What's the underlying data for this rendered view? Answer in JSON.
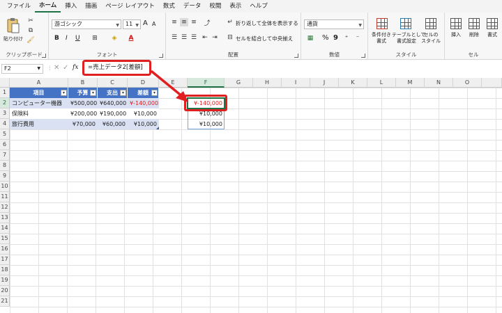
{
  "menu": [
    "ファイル",
    "ホーム",
    "挿入",
    "描画",
    "ページ レイアウト",
    "数式",
    "データ",
    "校閲",
    "表示",
    "ヘルプ"
  ],
  "ribbon": {
    "clipboard": {
      "paste": "貼り付け",
      "label": "クリップボード"
    },
    "font": {
      "name": "游ゴシック",
      "size": "11",
      "grow": "A",
      "shrink": "A",
      "bold": "B",
      "italic": "I",
      "underline": "U",
      "label": "フォント"
    },
    "alignment": {
      "wrap": "折り返して全体を表示する",
      "merge": "セルを結合して中央揃え",
      "label": "配置"
    },
    "number": {
      "format": "通貨",
      "percent": "%",
      "comma": "9",
      "label": "数値"
    },
    "styles": {
      "conditional": "条件付き\n書式",
      "table": "テーブルとして\n書式設定",
      "cell": "セルの\nスタイル",
      "label": "スタイル"
    },
    "cells": {
      "insert": "挿入",
      "delete": "削除",
      "format": "書式",
      "label": "セル"
    }
  },
  "formula_bar": {
    "name_box": "F2",
    "fx": "fx",
    "formula": "=売上データ2[差額]"
  },
  "columns": [
    "A",
    "B",
    "C",
    "D",
    "E",
    "F",
    "G",
    "H",
    "I",
    "J",
    "K",
    "L",
    "M",
    "N",
    "O"
  ],
  "rows": [
    "1",
    "2",
    "3",
    "4",
    "5",
    "6",
    "7",
    "8",
    "9",
    "10",
    "11",
    "12",
    "13",
    "14",
    "15",
    "16",
    "17",
    "18",
    "19",
    "20",
    "21"
  ],
  "table": {
    "headers": [
      "項目",
      "予算",
      "支出",
      "差額"
    ],
    "rows": [
      [
        "コンピューター機器",
        "¥500,000",
        "¥640,000",
        "¥-140,000"
      ],
      [
        "保険料",
        "¥200,000",
        "¥190,000",
        "¥10,000"
      ],
      [
        "旅行費用",
        "¥70,000",
        "¥60,000",
        "¥10,000"
      ]
    ]
  },
  "spill": [
    "¥-140,000",
    "¥10,000",
    "¥10,000"
  ]
}
